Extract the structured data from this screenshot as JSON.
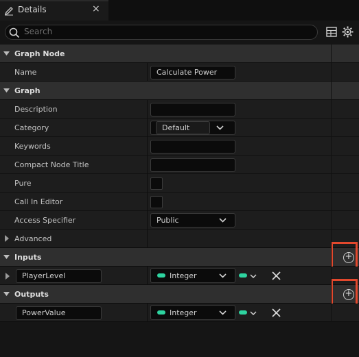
{
  "tab": {
    "title": "Details",
    "close": "×"
  },
  "search": {
    "placeholder": "Search"
  },
  "sections": {
    "graph_node": {
      "title": "Graph Node"
    },
    "graph": {
      "title": "Graph"
    },
    "advanced": {
      "title": "Advanced"
    },
    "inputs": {
      "title": "Inputs"
    },
    "outputs": {
      "title": "Outputs"
    }
  },
  "graph_node": {
    "name_label": "Name",
    "name_value": "Calculate Power"
  },
  "graph": {
    "description_label": "Description",
    "description_value": "",
    "category_label": "Category",
    "category_value": "Default",
    "keywords_label": "Keywords",
    "keywords_value": "",
    "compact_label": "Compact Node Title",
    "compact_value": "",
    "pure_label": "Pure",
    "call_in_editor_label": "Call In Editor",
    "access_label": "Access Specifier",
    "access_value": "Public"
  },
  "inputs": {
    "param_name": "PlayerLevel",
    "param_type": "Integer"
  },
  "outputs": {
    "param_name": "PowerValue",
    "param_type": "Integer"
  },
  "colors": {
    "accent_pin": "#2ed4a0",
    "highlight": "#e2482d"
  },
  "icons": [
    "pencil-icon",
    "search-icon",
    "table-icon",
    "gear-icon",
    "plus-circle-icon",
    "chevron-down-icon",
    "triangle-icon",
    "close-icon"
  ]
}
